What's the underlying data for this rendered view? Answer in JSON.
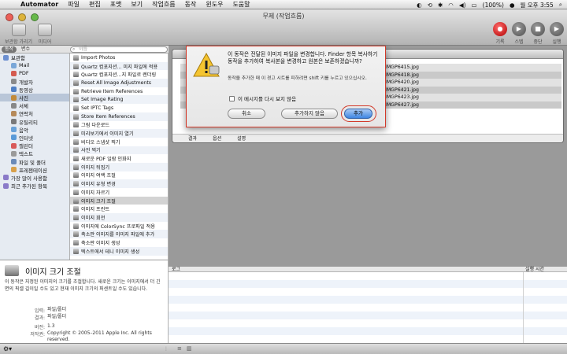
{
  "menubar": {
    "apple_glyph": "",
    "app_name": "Automator",
    "menus": [
      "파일",
      "편집",
      "포맷",
      "보기",
      "작업흐름",
      "동작",
      "윈도우",
      "도움말"
    ],
    "battery": "(100%)",
    "clock": "월 오후 3:55"
  },
  "window": {
    "title": "무제 (작업흐름)",
    "toolbar_left": [
      {
        "label": "보관함 가리기"
      },
      {
        "label": "미디어"
      }
    ],
    "toolbar_right": [
      {
        "label": "기록",
        "glyph": "●"
      },
      {
        "label": "스텝",
        "glyph": "▶"
      },
      {
        "label": "중단",
        "glyph": "■"
      },
      {
        "label": "실행",
        "glyph": "▶"
      }
    ]
  },
  "library": {
    "tab_actions": "동작",
    "tab_variables": "변수",
    "search_placeholder": "이름",
    "categories": [
      {
        "label": "보관함",
        "top": true,
        "color": "#6c8fd0"
      },
      {
        "label": "Mail",
        "color": "#7aa7d8"
      },
      {
        "label": "PDF",
        "color": "#d45b50"
      },
      {
        "label": "개발자",
        "color": "#8a8a8a"
      },
      {
        "label": "동영상",
        "color": "#4f7fc4"
      },
      {
        "label": "사진",
        "color": "#c28a3a",
        "selected": true
      },
      {
        "label": "서체",
        "color": "#888888"
      },
      {
        "label": "연락처",
        "color": "#b68a5a"
      },
      {
        "label": "유틸리티",
        "color": "#7a7a7a"
      },
      {
        "label": "음악",
        "color": "#6aa2d8"
      },
      {
        "label": "인터넷",
        "color": "#5a9ad8"
      },
      {
        "label": "캘린더",
        "color": "#d85a5a"
      },
      {
        "label": "텍스트",
        "color": "#9a9a9a"
      },
      {
        "label": "파일 및 폴더",
        "color": "#6a8ab8"
      },
      {
        "label": "프레젠테이션",
        "color": "#d8a04a"
      },
      {
        "label": "가장 많이 사용함",
        "top": true,
        "color": "#8a7ac8"
      },
      {
        "label": "최근 추가된 항목",
        "top": true,
        "color": "#8a7ac8"
      }
    ],
    "actions": [
      "Import Photos",
      "Quartz 컴포지션... 미지 파일에 적용",
      "Quartz 컴포지션...지 파일로 렌더링",
      "Reset All Image Adjustments",
      "Retrieve Item References",
      "Set Image Rating",
      "Set IPTC Tags",
      "Store Item References",
      "그림 다운로드",
      "미리보기에서 이미지 열기",
      "비디오 스냅샷 찍기",
      "사진 찍기",
      "새로운 PDF 일람 인화지",
      "이미지 뒤집기",
      "이미지 여백 조절",
      "이미지 유형 변경",
      "이미지 자르기",
      "이미지 크기 조절",
      "이미지 프린트",
      "이미지 회전",
      "이미지에 ColorSync 프로파일 적용",
      "축소판 이미지를 이미지 파일에 추가",
      "축소판 이미지 생성",
      "텍스트에서 테니 이미지 생성"
    ],
    "selected_action_index": 17
  },
  "description": {
    "title": "이미지 크기 조절",
    "body": "이 동작은 지정된 이미지의 크기를 조절합니다. 새로운 크기는 이미지에서 더 긴 면의 픽셀 길이일 수도 있고 현재 이미지 크기의 퍼센트일 수도 있습니다.",
    "meta": [
      {
        "key": "입력:",
        "value": "파일/폴더"
      },
      {
        "key": "결과:",
        "value": "파일/폴더"
      },
      {
        "key": "버전:",
        "value": "1.3"
      },
      {
        "key": "저작권:",
        "value": "Copyright © 2005–2011 Apple Inc. All rights reserved."
      }
    ]
  },
  "workflow": {
    "files": [
      "IMGP6415.jpg",
      "IMGP6418.jpg",
      "IMGP6420.jpg",
      "IMGP6421.jpg",
      "IMGP6423.jpg",
      "IMGP6427.jpg"
    ],
    "tabs": [
      "결과",
      "옵션",
      "설명"
    ]
  },
  "log": {
    "col_log": "로그",
    "col_duration": "실행 시간"
  },
  "dialog": {
    "message": "이 동작은 전달된 이미지 파일을 변경합니다. Finder 항목 복사하기 동작을 추가하여 복사본을 변경하고 원본은 보존하겠습니까?",
    "info": "동작을 추가한 때 이 경고 시트를 피하려면 shift 키를 누르고 있으십시오.",
    "checkbox_label": "이 메시지를 다시 보지 않음",
    "cancel_label": "취소",
    "dont_add_label": "추가하지 않음",
    "add_label": "추가"
  }
}
